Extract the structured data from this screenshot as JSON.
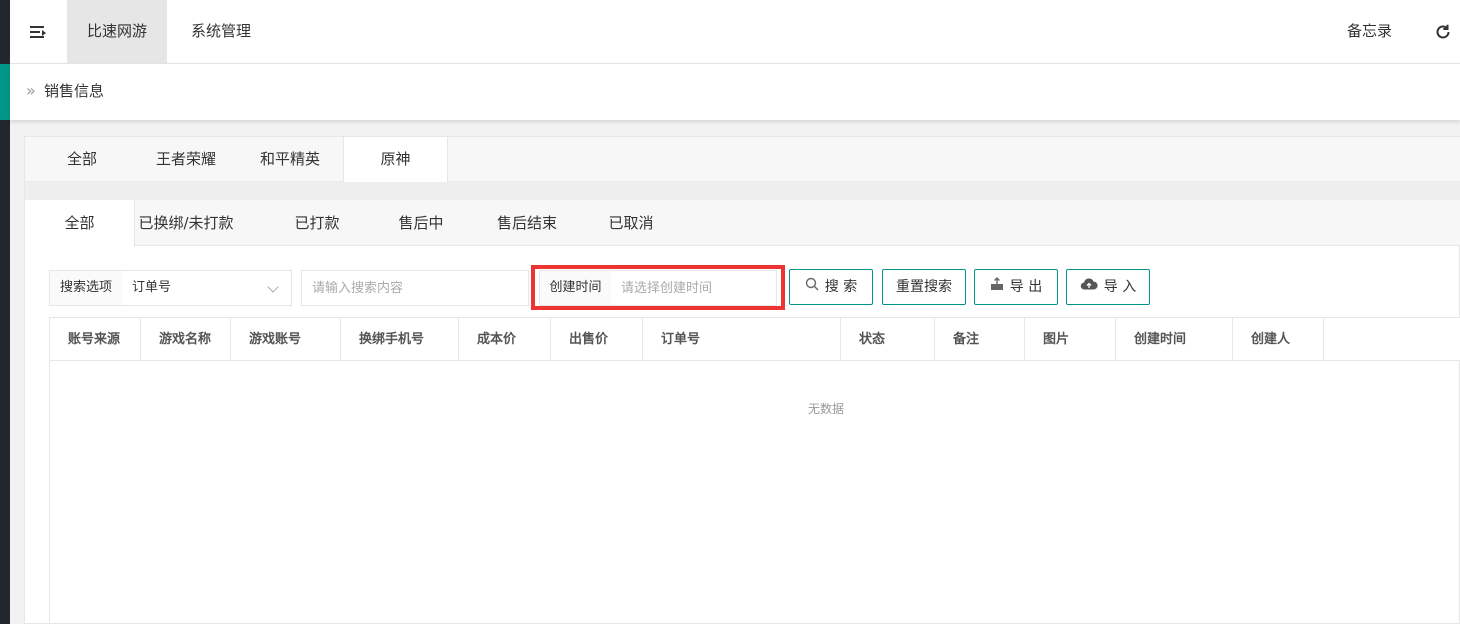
{
  "header": {
    "nav": [
      "比速网游",
      "系统管理"
    ],
    "right": {
      "memo": "备忘录"
    }
  },
  "breadcrumb": {
    "current": "销售信息"
  },
  "game_tabs": [
    "全部",
    "王者荣耀",
    "和平精英",
    "原神"
  ],
  "status_tabs": [
    "全部",
    "已换绑/未打款",
    "已打款",
    "售后中",
    "售后结束",
    "已取消"
  ],
  "search": {
    "option_label": "搜索选项",
    "option_value": "订单号",
    "keyword_placeholder": "请输入搜索内容",
    "time_label": "创建时间",
    "time_placeholder": "请选择创建时间",
    "search_button": "搜 索",
    "reset_button": "重置搜索",
    "export_button": "导 出",
    "import_button": "导 入"
  },
  "table": {
    "columns": [
      "账号来源",
      "游戏名称",
      "游戏账号",
      "换绑手机号",
      "成本价",
      "出售价",
      "订单号",
      "状态",
      "备注",
      "图片",
      "创建时间",
      "创建人"
    ],
    "empty_text": "无数据"
  },
  "colors": {
    "accent": "#009688",
    "highlight": "#ee3333",
    "sidebar": "#23262e"
  }
}
